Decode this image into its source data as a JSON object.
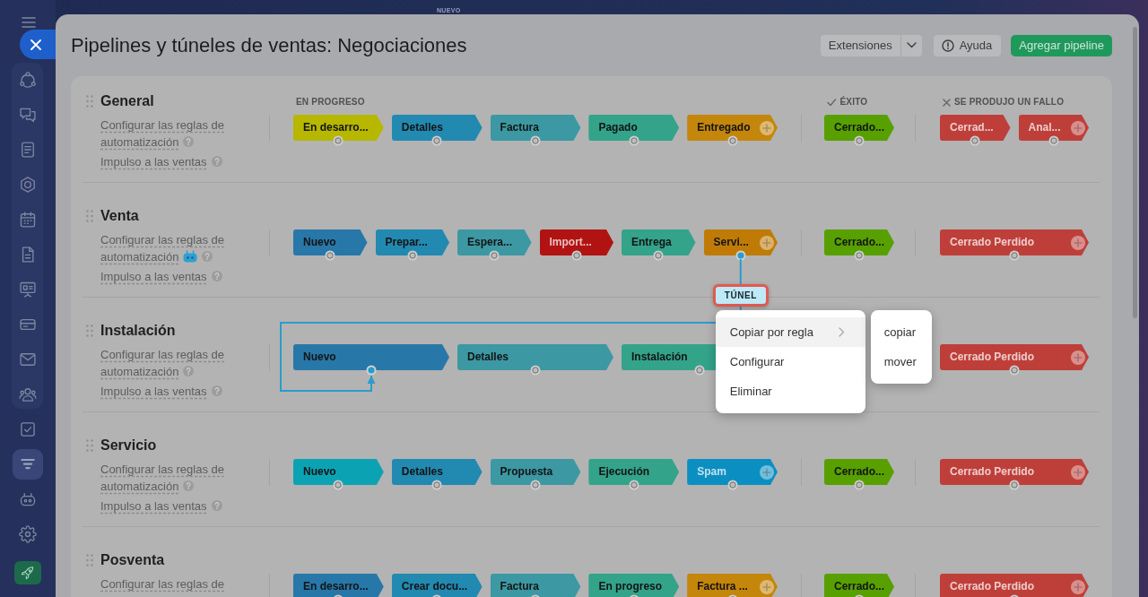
{
  "background": {
    "badge": "NUEVO"
  },
  "sidebar": {
    "items": [
      {
        "kind": "cycle",
        "selected": false
      },
      {
        "kind": "chat",
        "selected": false
      },
      {
        "kind": "list",
        "selected": false
      },
      {
        "kind": "hexagon",
        "selected": false
      },
      {
        "kind": "calendar",
        "selected": false
      },
      {
        "kind": "file",
        "selected": false
      },
      {
        "kind": "board",
        "selected": false
      },
      {
        "kind": "card",
        "selected": false
      },
      {
        "kind": "mail",
        "selected": false
      },
      {
        "kind": "people",
        "selected": false
      },
      {
        "kind": "task",
        "selected": false
      },
      {
        "kind": "funnel",
        "selected": true
      },
      {
        "kind": "robot",
        "selected": false
      },
      {
        "kind": "gear",
        "selected": false
      },
      {
        "kind": "rocket",
        "selected": false
      }
    ]
  },
  "window": {
    "title": "Pipelines y túneles de ventas: Negociaciones"
  },
  "toolbar": {
    "buttons": [
      {
        "kind": "split",
        "label": "Extensiones"
      },
      {
        "kind": "help",
        "label": "Ayuda"
      },
      {
        "kind": "primary",
        "label": "Agregar pipeline"
      }
    ]
  },
  "stage_groups": [
    {
      "kind": "progress",
      "label": "EN PROGRESO"
    },
    {
      "kind": "success",
      "label": "ÉXITO"
    },
    {
      "kind": "failure",
      "label": "SE PRODUJO UN FALLO"
    }
  ],
  "pipelines": [
    {
      "name": "General",
      "links": [
        {
          "text": "Configurar las reglas de automatización",
          "robot": false,
          "help": true
        },
        {
          "text": "Impulso a las ventas",
          "robot": false,
          "help": true
        }
      ],
      "groups": [
        {
          "kind": "progress",
          "stages": [
            {
              "label": "En desarro...",
              "color": "#b7b700",
              "light_text": false,
              "add": false,
              "tunnel": false
            },
            {
              "label": "Detalles",
              "color": "#2289b1",
              "light_text": false,
              "add": false,
              "tunnel": false
            },
            {
              "label": "Factura",
              "color": "#3c98a3",
              "light_text": false,
              "add": false,
              "tunnel": false
            },
            {
              "label": "Pagado",
              "color": "#33a38a",
              "light_text": false,
              "add": false,
              "tunnel": false
            },
            {
              "label": "Entregado",
              "color": "#c4860b",
              "light_text": false,
              "add": true,
              "tunnel": false
            }
          ]
        },
        {
          "kind": "success",
          "stages": [
            {
              "label": "Cerrado...",
              "color": "#57a000",
              "light_text": false,
              "add": false,
              "tunnel": false
            }
          ]
        },
        {
          "kind": "failure",
          "stages": [
            {
              "label": "Cerrad...",
              "color": "#be3f3a",
              "light_text": true,
              "add": false,
              "tunnel": false
            },
            {
              "label": "Anal...",
              "color": "#be3f3a",
              "light_text": true,
              "add": true,
              "tunnel": false
            }
          ]
        }
      ]
    },
    {
      "name": "Venta",
      "links": [
        {
          "text": "Configurar las reglas de automatización",
          "robot": true,
          "help": true
        },
        {
          "text": "Impulso a las ventas",
          "robot": false,
          "help": true
        }
      ],
      "groups": [
        {
          "kind": "progress",
          "stages": [
            {
              "label": "Nuevo",
              "color": "#2877a9",
              "light_text": false,
              "add": false,
              "tunnel": false
            },
            {
              "label": "Prepar...",
              "color": "#2289b1",
              "light_text": false,
              "add": false,
              "tunnel": false
            },
            {
              "label": "Espera...",
              "color": "#3c98a3",
              "light_text": false,
              "add": false,
              "tunnel": false
            },
            {
              "label": "Import...",
              "color": "#b11313",
              "light_text": true,
              "add": false,
              "tunnel": false
            },
            {
              "label": "Entrega",
              "color": "#33a38a",
              "light_text": false,
              "add": false,
              "tunnel": false
            },
            {
              "label": "Servi...",
              "color": "#c07b06",
              "light_text": false,
              "add": true,
              "tunnel": true
            }
          ]
        },
        {
          "kind": "success",
          "stages": [
            {
              "label": "Cerrado...",
              "color": "#57a000",
              "light_text": false,
              "add": false,
              "tunnel": false
            }
          ]
        },
        {
          "kind": "failure",
          "stages": [
            {
              "label": "Cerrado Perdido",
              "color": "#be3f3a",
              "light_text": true,
              "add": true,
              "tunnel": false
            }
          ]
        }
      ]
    },
    {
      "name": "Instalación",
      "links": [
        {
          "text": "Configurar las reglas de automatización",
          "robot": false,
          "help": true
        },
        {
          "text": "Impulso a las ventas",
          "robot": false,
          "help": true
        }
      ],
      "groups": [
        {
          "kind": "progress",
          "stages": [
            {
              "label": "Nuevo",
              "color": "#2877a9",
              "light_text": false,
              "add": false,
              "tunnel": true
            },
            {
              "label": "Detalles",
              "color": "#3c98a3",
              "light_text": false,
              "add": false,
              "tunnel": false
            },
            {
              "label": "Instalación",
              "color": "#33a38a",
              "light_text": false,
              "add": false,
              "tunnel": false
            }
          ]
        },
        {
          "kind": "failure",
          "stages": [
            {
              "label": "Cerrado Perdido",
              "color": "#be3f3a",
              "light_text": true,
              "add": true,
              "tunnel": false
            }
          ]
        }
      ]
    },
    {
      "name": "Servicio",
      "links": [
        {
          "text": "Configurar las reglas de automatización",
          "robot": false,
          "help": true
        },
        {
          "text": "Impulso a las ventas",
          "robot": false,
          "help": true
        }
      ],
      "groups": [
        {
          "kind": "progress",
          "stages": [
            {
              "label": "Nuevo",
              "color": "#0ba3b3",
              "light_text": false,
              "add": false,
              "tunnel": false
            },
            {
              "label": "Detalles",
              "color": "#2289b1",
              "light_text": false,
              "add": false,
              "tunnel": false
            },
            {
              "label": "Propuesta",
              "color": "#3c98a3",
              "light_text": false,
              "add": false,
              "tunnel": false
            },
            {
              "label": "Ejecución",
              "color": "#33a38a",
              "light_text": false,
              "add": false,
              "tunnel": false
            },
            {
              "label": "Spam",
              "color": "#0b8fc2",
              "light_text": true,
              "add": true,
              "tunnel": false
            }
          ]
        },
        {
          "kind": "success",
          "stages": [
            {
              "label": "Cerrado...",
              "color": "#57a000",
              "light_text": false,
              "add": false,
              "tunnel": false
            }
          ]
        },
        {
          "kind": "failure",
          "stages": [
            {
              "label": "Cerrado Perdido",
              "color": "#be3f3a",
              "light_text": true,
              "add": true,
              "tunnel": false
            }
          ]
        }
      ]
    },
    {
      "name": "Posventa",
      "links": [
        {
          "text": "Configurar las reglas de",
          "robot": false,
          "help": false
        }
      ],
      "groups": [
        {
          "kind": "progress",
          "stages": [
            {
              "label": "En desarro...",
              "color": "#2877a9",
              "light_text": false,
              "add": false,
              "tunnel": false
            },
            {
              "label": "Crear docu...",
              "color": "#2289b1",
              "light_text": false,
              "add": false,
              "tunnel": false
            },
            {
              "label": "Factura",
              "color": "#3c98a3",
              "light_text": false,
              "add": false,
              "tunnel": false
            },
            {
              "label": "En progreso",
              "color": "#33a38a",
              "light_text": false,
              "add": false,
              "tunnel": false
            },
            {
              "label": "Factura ...",
              "color": "#c4860b",
              "light_text": false,
              "add": true,
              "tunnel": false
            }
          ]
        },
        {
          "kind": "success",
          "stages": [
            {
              "label": "Cerrado...",
              "color": "#57a000",
              "light_text": false,
              "add": false,
              "tunnel": false
            }
          ]
        },
        {
          "kind": "failure",
          "stages": [
            {
              "label": "Cerrado Perdido",
              "color": "#be3f3a",
              "light_text": true,
              "add": true,
              "tunnel": false
            }
          ]
        }
      ]
    }
  ],
  "tunnel": {
    "label": "TÚNEL",
    "highlighted": true
  },
  "context_menu": {
    "items": [
      {
        "label": "Copiar por regla",
        "selected": true,
        "submenu": true
      },
      {
        "label": "Configurar",
        "selected": false,
        "submenu": false
      },
      {
        "label": "Eliminar",
        "selected": false,
        "submenu": false
      }
    ],
    "submenu": {
      "items": [
        {
          "label": "copiar"
        },
        {
          "label": "mover"
        }
      ]
    }
  }
}
